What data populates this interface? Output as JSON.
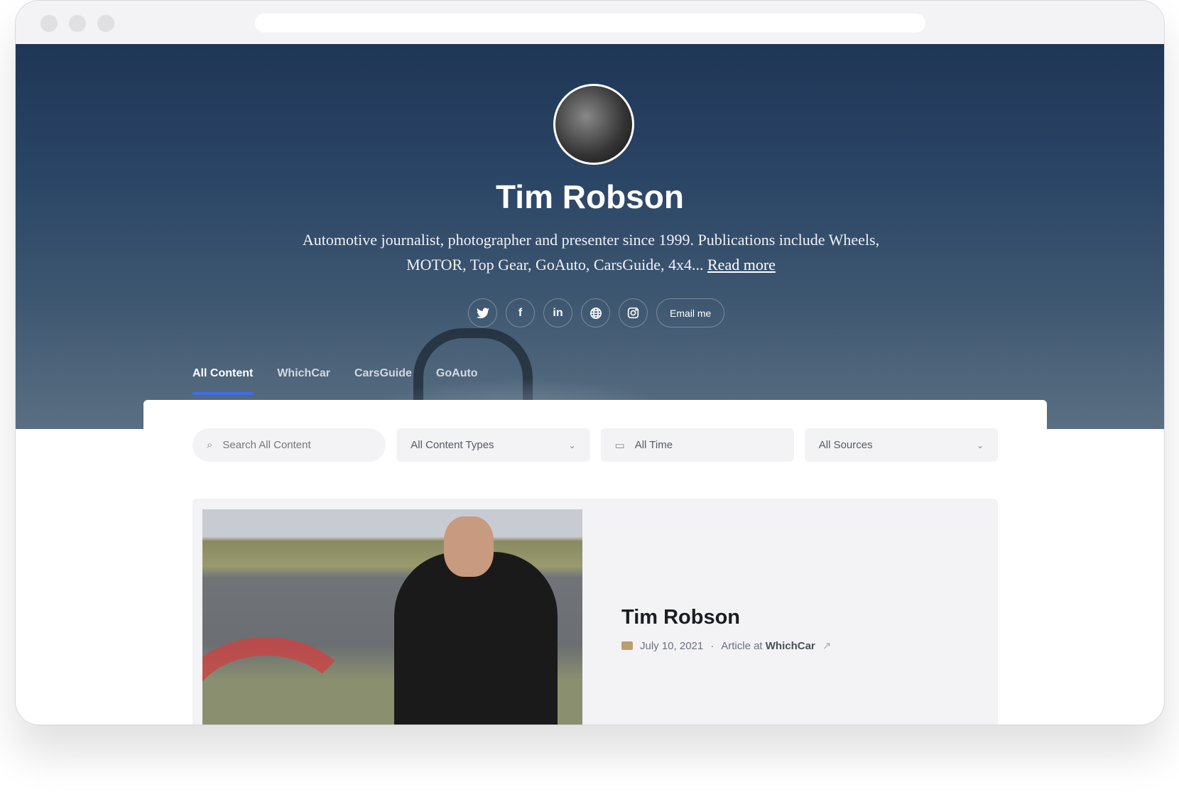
{
  "profile": {
    "name": "Tim Robson",
    "bio": "Automotive journalist, photographer and presenter since 1999. Publications include Wheels, MOTOR, Top Gear, GoAuto, CarsGuide, 4x4...",
    "read_more": "Read more"
  },
  "socials": [
    {
      "icon": "twitter-icon",
      "glyph": "🐦"
    },
    {
      "icon": "facebook-icon",
      "glyph": "f"
    },
    {
      "icon": "linkedin-icon",
      "glyph": "in"
    },
    {
      "icon": "globe-icon",
      "glyph": "🌐"
    },
    {
      "icon": "instagram-icon",
      "glyph": "◎"
    }
  ],
  "email_label": "Email me",
  "tabs": [
    {
      "label": "All Content",
      "active": true
    },
    {
      "label": "WhichCar"
    },
    {
      "label": "CarsGuide"
    },
    {
      "label": "GoAuto"
    }
  ],
  "filters": {
    "search_placeholder": "Search All Content",
    "content_types": "All Content Types",
    "time": "All Time",
    "sources": "All Sources"
  },
  "article": {
    "title": "Tim Robson",
    "date": "July 10, 2021",
    "type_prefix": "Article at",
    "source": "WhichCar"
  },
  "colors": {
    "accent": "#3b6ef0",
    "hero": "#2b4566"
  }
}
